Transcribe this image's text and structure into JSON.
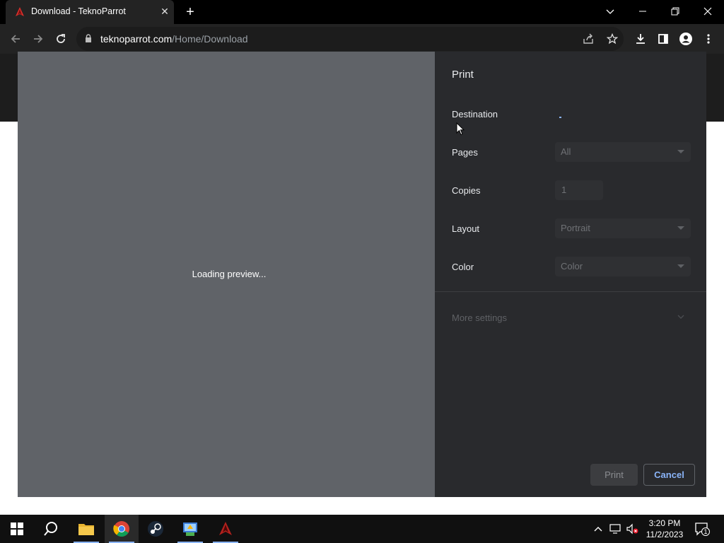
{
  "browser": {
    "tab_title": "Download - TeknoParrot",
    "url_host": "teknoparrot.com",
    "url_path": "/Home/Download"
  },
  "preview": {
    "loading_text": "Loading preview..."
  },
  "print_panel": {
    "title": "Print",
    "destination_label": "Destination",
    "pages_label": "Pages",
    "pages_value": "All",
    "copies_label": "Copies",
    "copies_value": "1",
    "layout_label": "Layout",
    "layout_value": "Portrait",
    "color_label": "Color",
    "color_value": "Color",
    "more_settings": "More settings",
    "print_button": "Print",
    "cancel_button": "Cancel"
  },
  "taskbar": {
    "time": "3:20 PM",
    "date": "11/2/2023",
    "notification_count": "1"
  },
  "colors": {
    "accent": "#8ab4f8",
    "panel_bg": "#292a2d",
    "preview_bg": "#606368"
  }
}
